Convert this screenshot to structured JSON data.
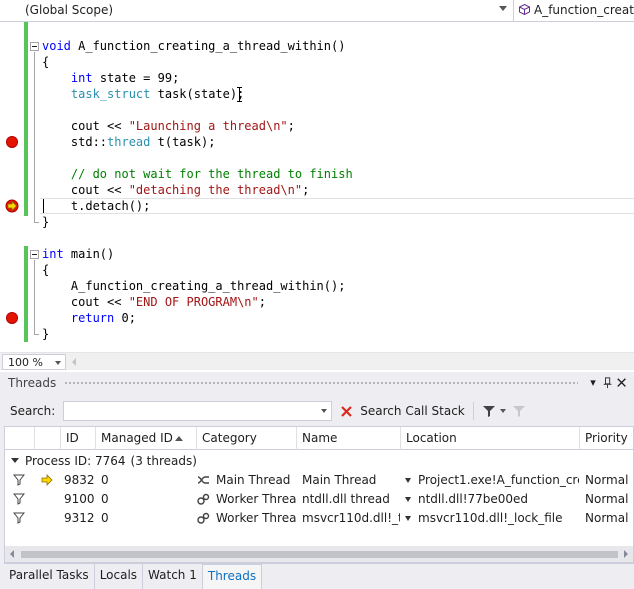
{
  "navbar": {
    "scope": "(Global Scope)",
    "member": "A_function_creatin"
  },
  "code": {
    "lines": [
      {
        "indent": "",
        "tokens": [
          {
            "c": "kw",
            "t": "void"
          },
          {
            "c": "plain",
            "t": " A_function_creating_a_thread_within()"
          }
        ]
      },
      {
        "indent": "",
        "tokens": [
          {
            "c": "plain",
            "t": "{"
          }
        ]
      },
      {
        "indent": "    ",
        "tokens": [
          {
            "c": "kw",
            "t": "int"
          },
          {
            "c": "plain",
            "t": " state = 99;"
          }
        ]
      },
      {
        "indent": "    ",
        "tokens": [
          {
            "c": "ty",
            "t": "task_struct"
          },
          {
            "c": "plain",
            "t": " task(state);"
          }
        ]
      },
      {
        "indent": "",
        "tokens": []
      },
      {
        "indent": "    ",
        "tokens": [
          {
            "c": "plain",
            "t": "cout << "
          },
          {
            "c": "str",
            "t": "\"Launching a thread\\n\""
          },
          {
            "c": "plain",
            "t": ";"
          }
        ]
      },
      {
        "indent": "    ",
        "tokens": [
          {
            "c": "plain",
            "t": "std::"
          },
          {
            "c": "ty",
            "t": "thread"
          },
          {
            "c": "plain",
            "t": " t(task);"
          }
        ]
      },
      {
        "indent": "",
        "tokens": []
      },
      {
        "indent": "    ",
        "tokens": [
          {
            "c": "cmt",
            "t": "// do not wait for the thread to finish"
          }
        ]
      },
      {
        "indent": "    ",
        "tokens": [
          {
            "c": "plain",
            "t": "cout << "
          },
          {
            "c": "str",
            "t": "\"detaching the thread\\n\""
          },
          {
            "c": "plain",
            "t": ";"
          }
        ]
      },
      {
        "indent": "    ",
        "tokens": [
          {
            "c": "plain",
            "t": "t.detach();"
          }
        ]
      },
      {
        "indent": "",
        "tokens": [
          {
            "c": "plain",
            "t": "}"
          }
        ]
      },
      {
        "indent": "",
        "tokens": []
      },
      {
        "indent": "",
        "tokens": [
          {
            "c": "kw",
            "t": "int"
          },
          {
            "c": "plain",
            "t": " main()"
          }
        ]
      },
      {
        "indent": "",
        "tokens": [
          {
            "c": "plain",
            "t": "{"
          }
        ]
      },
      {
        "indent": "    ",
        "tokens": [
          {
            "c": "plain",
            "t": "A_function_creating_a_thread_within();"
          }
        ]
      },
      {
        "indent": "    ",
        "tokens": [
          {
            "c": "plain",
            "t": "cout << "
          },
          {
            "c": "str",
            "t": "\"END OF PROGRAM\\n\""
          },
          {
            "c": "plain",
            "t": ";"
          }
        ]
      },
      {
        "indent": "    ",
        "tokens": [
          {
            "c": "kw",
            "t": "return"
          },
          {
            "c": "plain",
            "t": " 0;"
          }
        ]
      },
      {
        "indent": "",
        "tokens": [
          {
            "c": "plain",
            "t": "}"
          }
        ]
      }
    ],
    "breakpoint_lines": [
      6,
      17
    ],
    "current_statement_line": 10
  },
  "zoom": "100 %",
  "threads": {
    "title": "Threads",
    "search_label": "Search:",
    "search_value": "",
    "search_call_stack": "Search Call Stack",
    "columns": [
      "ID",
      "Managed ID",
      "Category",
      "Name",
      "Location",
      "Priority"
    ],
    "group": {
      "label": "Process ID: 7764",
      "count": "(3 threads)"
    },
    "rows": [
      {
        "id": "9832",
        "managed_id": "0",
        "category": "Main Thread",
        "name": "Main Thread",
        "location": "Project1.exe!A_function_crea",
        "priority": "Normal",
        "current": true
      },
      {
        "id": "9100",
        "managed_id": "0",
        "category": "Worker Thread",
        "name": "ntdll.dll thread",
        "location": "ntdll.dll!77be00ed",
        "priority": "Normal",
        "current": false
      },
      {
        "id": "9312",
        "managed_id": "0",
        "category": "Worker Thread",
        "name": "msvcr110d.dll!_tl",
        "location": "msvcr110d.dll!_lock_file",
        "priority": "Normal",
        "current": false
      }
    ]
  },
  "tabs": [
    {
      "label": "Parallel Tasks",
      "active": false
    },
    {
      "label": "Locals",
      "active": false
    },
    {
      "label": "Watch 1",
      "active": false
    },
    {
      "label": "Threads",
      "active": true
    }
  ],
  "colors": {
    "keyword": "#0000ff",
    "type": "#2b91af",
    "string": "#a31515",
    "comment": "#008000",
    "breakpoint": "#e51400",
    "change_bar": "#58c45a",
    "active_tab": "#0e70c0"
  }
}
